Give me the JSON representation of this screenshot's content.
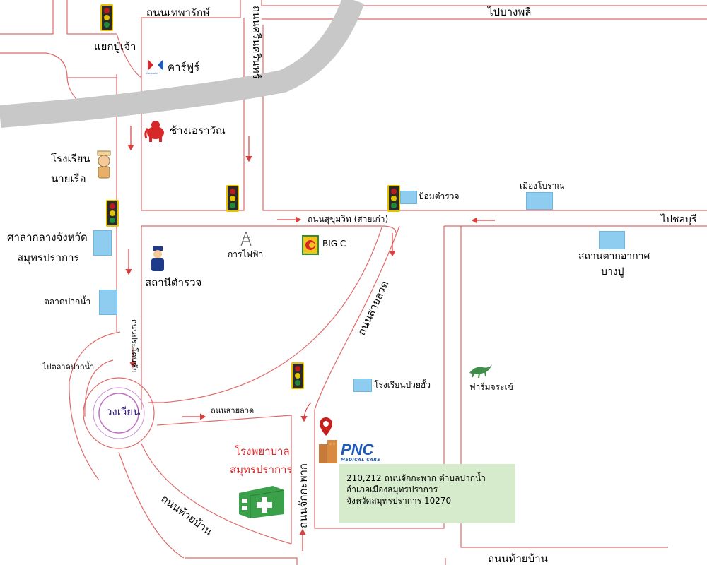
{
  "colors": {
    "road_edge": "#e06a6a",
    "highway": "#c8c8c8",
    "place_box": "#8ecdf0",
    "info_bg": "#d6ebcc",
    "hospital_red": "#d62828",
    "roundabout_purple": "#3a2080"
  },
  "roads": {
    "thepharak": "ถนนเทพารักษ์",
    "srinakarin": "ถนนศรีนครินทร์",
    "to_bangphli": "ไปบางพลี",
    "sukhumvit": "ถนนสุขุมวิท (สายเก่า)",
    "to_chonburi": "ไปชลบุรี",
    "sailuat_diag": "ถนนสายลวด",
    "prakonchai": "ถนนประโคนชัย",
    "sailuat_low": "ถนนสายลวด",
    "chakkraphak": "ถนนจักกะพาก",
    "thaiban": "ถนนท้ายบ้าน",
    "thaiban_bottom": "ถนนท้ายบ้าน",
    "to_paknam_market": "ไปตลาดปากน้ำ"
  },
  "places": {
    "puchao_junction": "แยกปู่เจ้า",
    "carrefour": "คาร์ฟูร์",
    "carrefour_logo_text": "Carrefour",
    "erawan": "ช้างเอราวัณ",
    "naval_school_1": "โรงเรียน",
    "naval_school_2": "นายเรือ",
    "city_hall_1": "ศาลากลางจังหวัด",
    "city_hall_2": "สมุทรปราการ",
    "paknam_market": "ตลาดปากน้ำ",
    "police_station": "สถานีตำรวจ",
    "electricity": "การไฟฟ้า",
    "bigc": "BIG C",
    "police_box": "ป้อมตำรวจ",
    "ancient_city": "เมืองโบราณ",
    "bangpu_1": "สถานตากอากาศ",
    "bangpu_2": "บางปู",
    "poiyua_school": "โรงเรียนป่วยฮั้ว",
    "croc_farm": "ฟาร์มจระเข้",
    "roundabout": "วงเวียน",
    "hospital_1": "โรงพยาบาล",
    "hospital_2": "สมุทรปราการ"
  },
  "clinic": {
    "name": "PNC",
    "tagline": "MEDICAL CARE",
    "address_line1": "210,212 ถนนจักกะพาก ตำบลปากน้ำ",
    "address_line2": "อำเภอเมืองสมุทรปราการ",
    "address_line3": "จังหวัดสมุทรปราการ 10270"
  },
  "icons": [
    "traffic-light-icon",
    "carrefour-logo-icon",
    "erawan-elephant-icon",
    "naval-cadet-icon",
    "police-officer-icon",
    "electricity-tower-icon",
    "bigc-logo-icon",
    "crocodile-icon",
    "hospital-building-icon",
    "location-pin-icon",
    "clinic-building-icon"
  ]
}
